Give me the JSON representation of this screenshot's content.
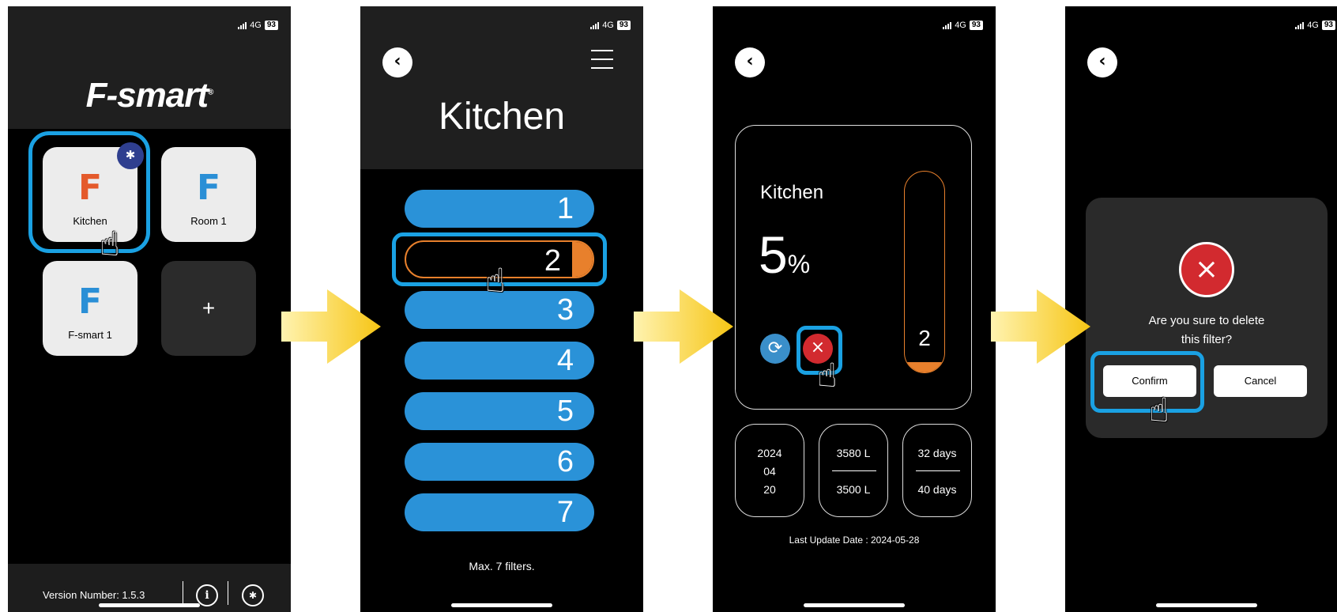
{
  "status": {
    "network": "4G",
    "battery": "93"
  },
  "screen1": {
    "logo": "F-smart",
    "logo_mark": "®",
    "tiles": [
      {
        "label": "Kitchen",
        "icon": "F",
        "icon_color": "#e45a2b"
      },
      {
        "label": "Room 1",
        "icon": "F",
        "icon_color": "#2a8fd6"
      },
      {
        "label": "F-smart 1",
        "icon": "F",
        "icon_color": "#2a8fd6"
      }
    ],
    "add_label": "+",
    "version": "Version Number: 1.5.3"
  },
  "screen2": {
    "title": "Kitchen",
    "filters": [
      "1",
      "2",
      "3",
      "4",
      "5",
      "6",
      "7"
    ],
    "selected_filter": "2",
    "note": "Max. 7 filters."
  },
  "screen3": {
    "title": "Kitchen",
    "percent_value": "5",
    "percent_unit": "%",
    "percent_fraction": 0.05,
    "filter_number": "2",
    "stats": {
      "date": [
        "2024",
        "04",
        "20"
      ],
      "volume": [
        "3580 L",
        "3500 L"
      ],
      "days": [
        "32  days",
        "40 days"
      ]
    },
    "last_update": "Last Update Date : 2024-05-28"
  },
  "screen4": {
    "message_line1": "Are you sure to delete",
    "message_line2": "this filter?",
    "confirm": "Confirm",
    "cancel": "Cancel"
  },
  "colors": {
    "highlight": "#1aa1e3",
    "filter_blue": "#2a92d8",
    "accent_orange": "#e8802c",
    "delete_red": "#d22a2f",
    "arrow_yellow": "#f6c514"
  },
  "icons": [
    "bluetooth-icon",
    "info-icon",
    "bluetooth-refresh-icon",
    "back-chevron-icon",
    "menu-icon",
    "refresh-icon",
    "close-icon",
    "pointer-hand-icon"
  ]
}
